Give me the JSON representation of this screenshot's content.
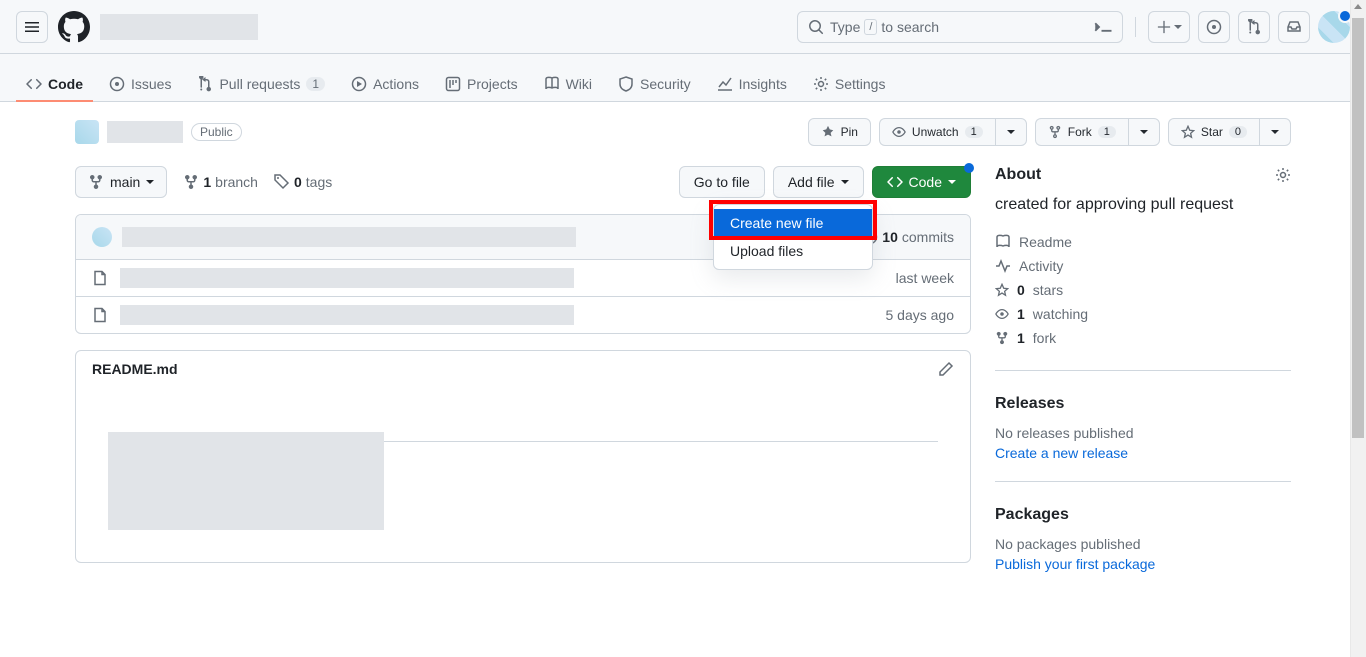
{
  "header": {
    "search_prefix": "Type",
    "search_slash": "/",
    "search_suffix": "to search"
  },
  "nav": {
    "code": "Code",
    "issues": "Issues",
    "pulls": "Pull requests",
    "pulls_count": "1",
    "actions": "Actions",
    "projects": "Projects",
    "wiki": "Wiki",
    "security": "Security",
    "insights": "Insights",
    "settings": "Settings"
  },
  "repo": {
    "visibility": "Public",
    "pin": "Pin",
    "unwatch": "Unwatch",
    "watch_count": "1",
    "fork": "Fork",
    "fork_count": "1",
    "star": "Star",
    "star_count": "0"
  },
  "filenav": {
    "branch": "main",
    "branch_count": "1",
    "branch_label": "branch",
    "tag_count": "0",
    "tag_label": "tags",
    "go_to_file": "Go to file",
    "add_file": "Add file",
    "code_btn": "Code"
  },
  "dropdown": {
    "create_new_file": "Create new file",
    "upload_files": "Upload files"
  },
  "commits": {
    "count": "10",
    "label": "commits"
  },
  "files": [
    {
      "time": "last week"
    },
    {
      "time": "5 days ago"
    }
  ],
  "readme": {
    "title": "README.md"
  },
  "about": {
    "title": "About",
    "description": "created for approving pull request",
    "readme": "Readme",
    "activity": "Activity",
    "stars_count": "0",
    "stars_label": "stars",
    "watching_count": "1",
    "watching_label": "watching",
    "fork_count": "1",
    "fork_label": "fork"
  },
  "releases": {
    "title": "Releases",
    "none": "No releases published",
    "create": "Create a new release"
  },
  "packages": {
    "title": "Packages",
    "none": "No packages published",
    "publish": "Publish your first package"
  }
}
